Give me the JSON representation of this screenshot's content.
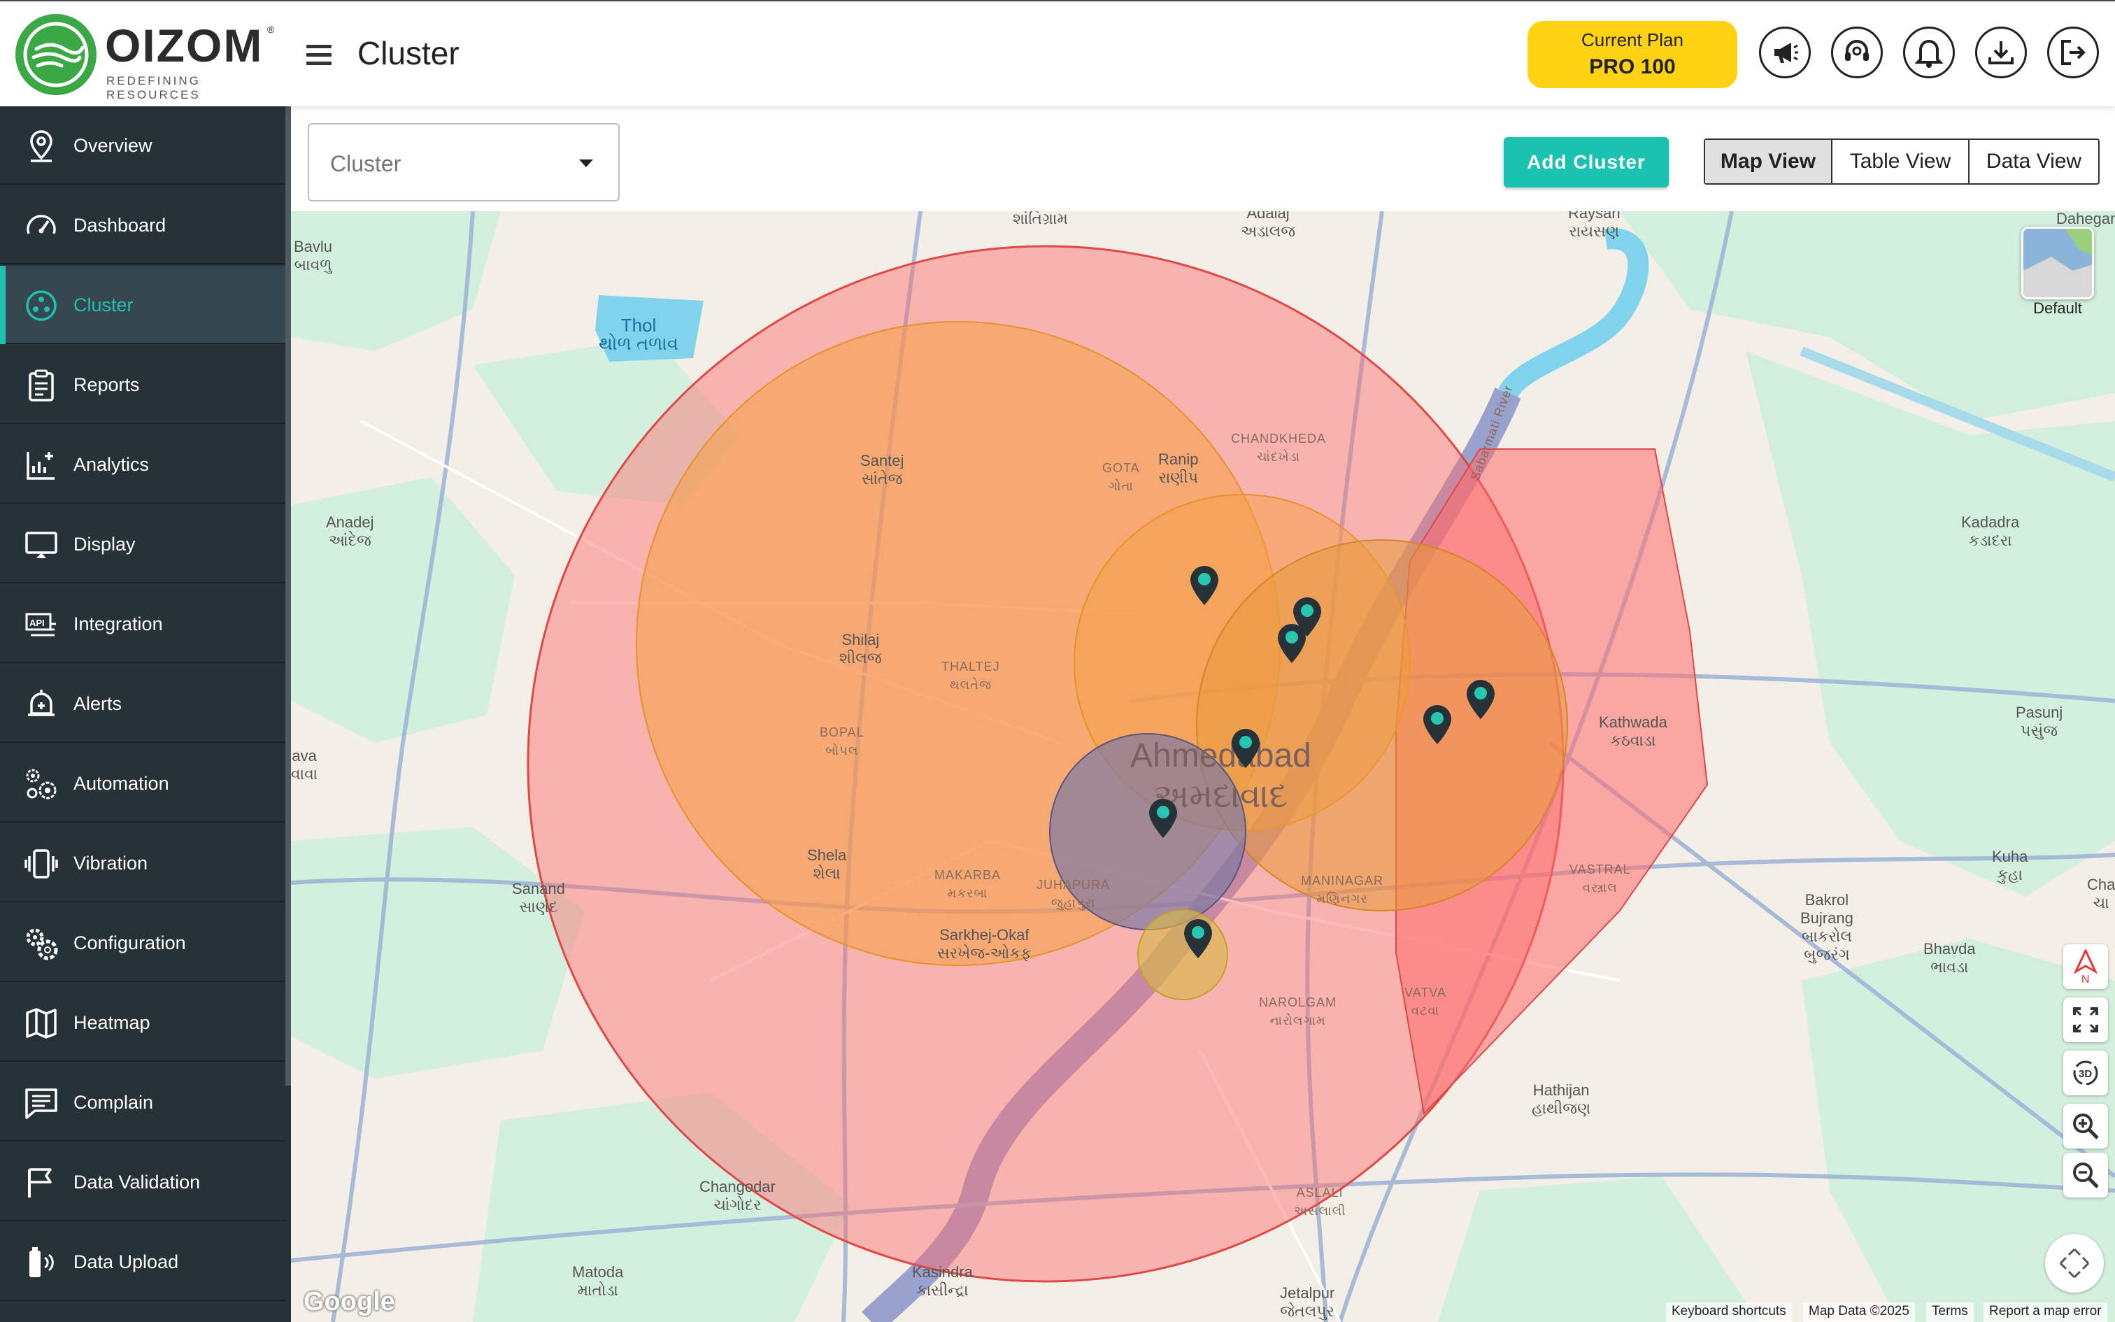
{
  "brand": {
    "name": "OIZOM",
    "tagline": "REDEFINING RESOURCES",
    "registered": "®",
    "color": "#3aa845"
  },
  "header": {
    "title": "Cluster",
    "plan_label": "Current Plan",
    "plan_name": "PRO 100",
    "icons": [
      "megaphone-icon",
      "support-icon",
      "bell-icon",
      "download-icon",
      "logout-icon"
    ]
  },
  "sidebar": {
    "items": [
      {
        "label": "Overview",
        "icon": "location-pin-icon"
      },
      {
        "label": "Dashboard",
        "icon": "speedometer-icon"
      },
      {
        "label": "Cluster",
        "icon": "cluster-icon",
        "active": true
      },
      {
        "label": "Reports",
        "icon": "clipboard-icon"
      },
      {
        "label": "Analytics",
        "icon": "analytics-icon"
      },
      {
        "label": "Display",
        "icon": "monitor-icon"
      },
      {
        "label": "Integration",
        "icon": "api-icon"
      },
      {
        "label": "Alerts",
        "icon": "alert-bell-icon"
      },
      {
        "label": "Automation",
        "icon": "gears-icon"
      },
      {
        "label": "Vibration",
        "icon": "vibration-icon"
      },
      {
        "label": "Configuration",
        "icon": "config-gears-icon"
      },
      {
        "label": "Heatmap",
        "icon": "map-icon"
      },
      {
        "label": "Complain",
        "icon": "message-icon"
      },
      {
        "label": "Data Validation",
        "icon": "flag-icon"
      },
      {
        "label": "Data Upload",
        "icon": "upload-device-icon"
      }
    ],
    "accent": "#1fc0b0",
    "background": "#263238"
  },
  "toolbar": {
    "cluster_select": "Cluster",
    "add_cluster": "Add Cluster",
    "views": [
      "Map View",
      "Table View",
      "Data View"
    ],
    "selected_view": "Map View"
  },
  "map": {
    "layer_label": "Default",
    "compass_label": "N",
    "attribution": {
      "keyboard": "Keyboard shortcuts",
      "data": "Map Data ©2025",
      "terms": "Terms",
      "report": "Report a map error"
    },
    "google": "Google",
    "labels": [
      {
        "text": "Bavlu\nબાવળુ",
        "type": "normal"
      },
      {
        "text": "Thol\nથોળ તળાવ",
        "type": "water"
      },
      {
        "text": "Santej\nસાંતેજ",
        "type": "normal"
      },
      {
        "text": "Anadej\nઆંદેજ",
        "type": "normal"
      },
      {
        "text": "Shilaj\nશીલજ",
        "type": "normal"
      },
      {
        "text": "THALTEJ\nથલતેજ",
        "type": "small"
      },
      {
        "text": "BOPAL\nબોપલ",
        "type": "small"
      },
      {
        "text": "ava\nવાવા",
        "type": "normal"
      },
      {
        "text": "Shela\nશેલા",
        "type": "normal"
      },
      {
        "text": "Sanand\nસાણંદ",
        "type": "normal"
      },
      {
        "text": "MAKARBA\nમકરબા",
        "type": "small"
      },
      {
        "text": "JUHAPURA\nજુહાપુરા",
        "type": "small"
      },
      {
        "text": "Sarkhej-Okaf\nસરખેજ-ઓકફ",
        "type": "normal"
      },
      {
        "text": "GOTA\nગોતા",
        "type": "small"
      },
      {
        "text": "Ranip\nરાણીપ",
        "type": "normal"
      },
      {
        "text": "CHANDKHEDA\nચાંદખેડા",
        "type": "small"
      },
      {
        "text": "Ahmedabad\nઅમદાવાદ",
        "type": "city"
      },
      {
        "text": "MANINAGAR\nમણિનગર",
        "type": "small"
      },
      {
        "text": "NAROLGAM\nનારોલગામ",
        "type": "small"
      },
      {
        "text": "VATVA\nવટવા",
        "type": "small"
      },
      {
        "text": "VASTRAL\nવસ્ત્રાલ",
        "type": "small"
      },
      {
        "text": "Kathwada\nકઠવાડા",
        "type": "normal"
      },
      {
        "text": "Kadadra\nકડાદરા",
        "type": "normal"
      },
      {
        "text": "Pasunj\nપસુંજ",
        "type": "normal"
      },
      {
        "text": "Kuha\nકુહા",
        "type": "normal"
      },
      {
        "text": "Cha\nચા",
        "type": "normal"
      },
      {
        "text": "Bakrol\nBujrang\nબાકરોલ\nબુજરંગ",
        "type": "normal"
      },
      {
        "text": "Bhavda\nભાવડા",
        "type": "normal"
      },
      {
        "text": "Hathijan\nહાથીજણ",
        "type": "normal"
      },
      {
        "text": "ASLALI\nઅસલાલી",
        "type": "small"
      },
      {
        "text": "Changodar\nચાંગોદર",
        "type": "normal"
      },
      {
        "text": "Matoda\nમાતોડા",
        "type": "normal"
      },
      {
        "text": "Kasindra\nકાસીન્દ્રા",
        "type": "normal"
      },
      {
        "text": "Jetalpur\nજેતલપુર",
        "type": "normal"
      },
      {
        "text": "Raysan\nરાયસણ",
        "type": "normal"
      },
      {
        "text": "Adalaj\nઅડાલજ",
        "type": "normal"
      },
      {
        "text": "શાંતિગ્રામ",
        "type": "normal"
      },
      {
        "text": "Dahegam",
        "type": "normal"
      },
      {
        "text": "Sabarmati River",
        "type": "small"
      }
    ],
    "colors": {
      "outer": "#ff6b6b",
      "orange": "#f5a043",
      "purple": "#7e7aa3",
      "yellow": "#d9b84a",
      "marker": "#263238",
      "marker_dot": "#26c6b0"
    }
  }
}
